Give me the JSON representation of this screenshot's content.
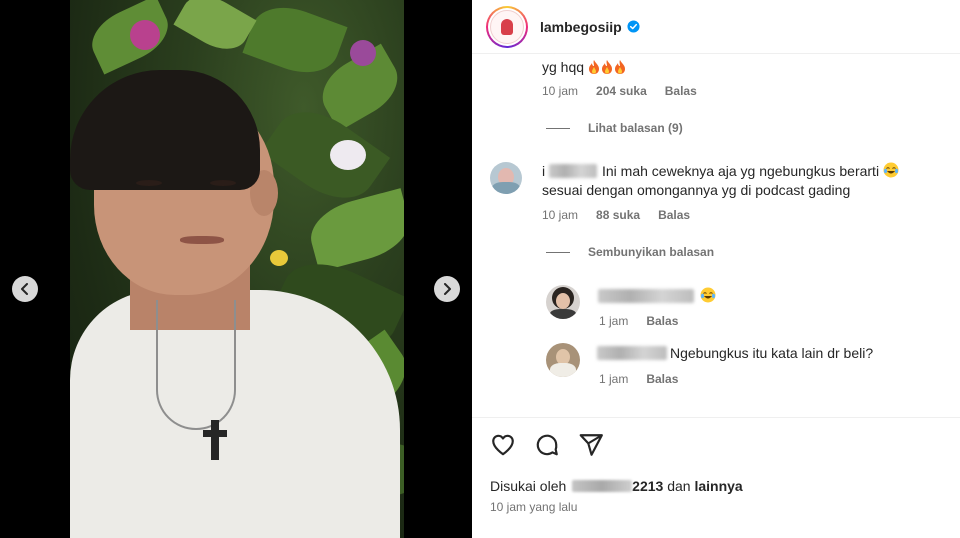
{
  "post": {
    "username": "lambegosiip",
    "verified": true,
    "time_ago": "10 jam yang lalu",
    "liked_by_prefix": "Disukai oleh",
    "liked_by_user_suffix": "2213",
    "liked_by_and": "dan",
    "liked_by_others": "lainnya"
  },
  "comments": [
    {
      "text": "yg hqq",
      "emoji": [
        "fire",
        "fire",
        "fire"
      ],
      "time": "10 jam",
      "likes": "204 suka",
      "reply": "Balas",
      "toggle": "Lihat balasan (9)"
    },
    {
      "author_initial": "i",
      "text_line1": "Ini mah ceweknya aja yg ngebungkus berarti",
      "text_line2": "sesuai dengan omongannya yg di podcast gading",
      "emoji": [
        "tears-of-joy"
      ],
      "time": "10 jam",
      "likes": "88 suka",
      "reply": "Balas",
      "toggle": "Sembunyikan balasan",
      "replies": [
        {
          "text": "",
          "emoji": [
            "tears-of-joy"
          ],
          "time": "1 jam",
          "reply": "Balas"
        },
        {
          "text": "Ngebungkus itu kata lain dr beli?",
          "time": "1 jam",
          "reply": "Balas"
        }
      ]
    }
  ],
  "icons": {
    "prev": "chevron-left-icon",
    "next": "chevron-right-icon",
    "like": "heart-icon",
    "comment": "comment-icon",
    "share": "send-icon",
    "verified": "verified-badge-icon"
  },
  "colors": {
    "text": "#262626",
    "secondary": "#737373",
    "verified": "#0095f6",
    "fire": "#f26522"
  }
}
